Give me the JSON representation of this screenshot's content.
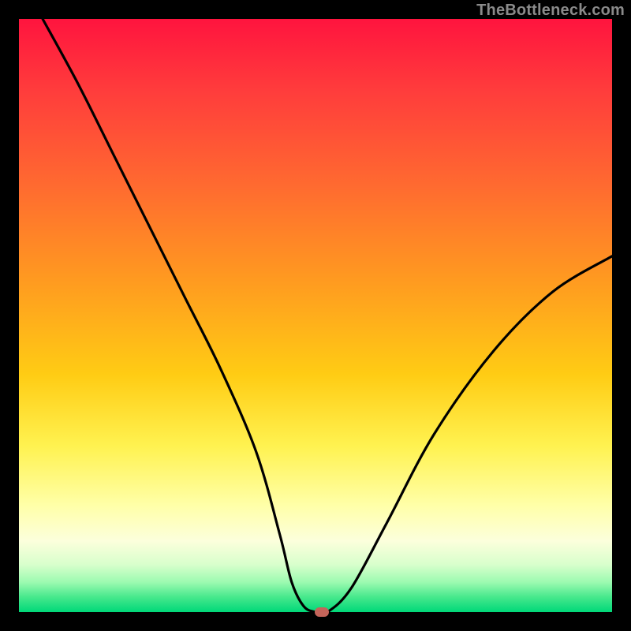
{
  "watermark": "TheBottleneck.com",
  "chart_data": {
    "type": "line",
    "title": "",
    "xlabel": "",
    "ylabel": "",
    "xlim": [
      0,
      100
    ],
    "ylim": [
      0,
      100
    ],
    "series": [
      {
        "name": "bottleneck-curve",
        "x": [
          4,
          10,
          16,
          22,
          28,
          34,
          40,
          44,
          46,
          48,
          50,
          52,
          56,
          62,
          70,
          80,
          90,
          100
        ],
        "y": [
          100,
          89,
          77,
          65,
          53,
          41,
          27,
          13,
          5,
          1,
          0,
          0,
          4,
          15,
          30,
          44,
          54,
          60
        ]
      }
    ],
    "marker": {
      "x": 51,
      "y": 0,
      "color": "#c4645a"
    },
    "background_gradient": {
      "top": "#ff143e",
      "bottom": "#00d879"
    }
  }
}
